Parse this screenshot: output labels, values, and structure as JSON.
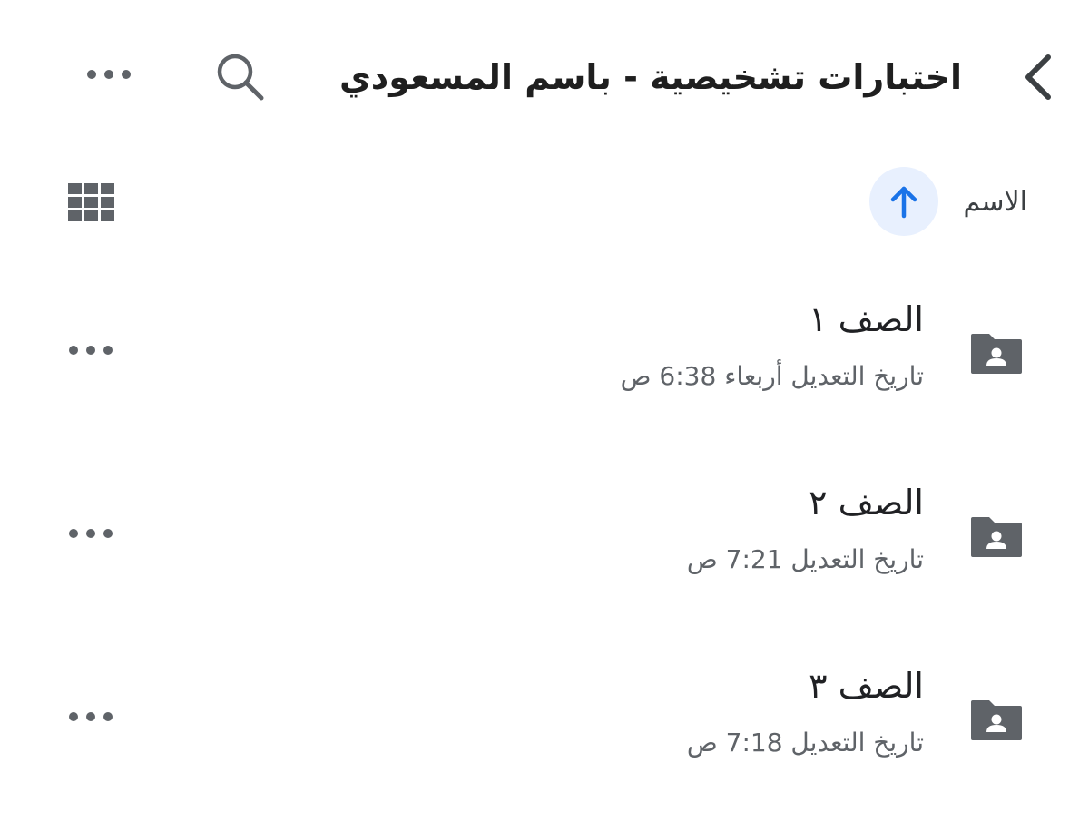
{
  "header": {
    "title": "اختبارات تشخيصية - باسم المسعودي",
    "back_icon": "chevron-left-icon",
    "search_icon": "search-icon",
    "more_icon": "more-horizontal-icon"
  },
  "sort": {
    "label": "الاسم",
    "direction_icon": "arrow-up-icon",
    "view_icon": "grid-view-icon"
  },
  "colors": {
    "accent": "#1a73e8",
    "accent_bg": "#e8f0fe",
    "icon_gray": "#5f6368"
  },
  "files": [
    {
      "name": "الصف ١",
      "modified": "تاريخ التعديل أربعاء 6:38 ص",
      "icon": "shared-folder-icon"
    },
    {
      "name": "الصف ٢",
      "modified": "تاريخ التعديل 7:21 ص",
      "icon": "shared-folder-icon"
    },
    {
      "name": "الصف ٣",
      "modified": "تاريخ التعديل 7:18 ص",
      "icon": "shared-folder-icon"
    }
  ]
}
